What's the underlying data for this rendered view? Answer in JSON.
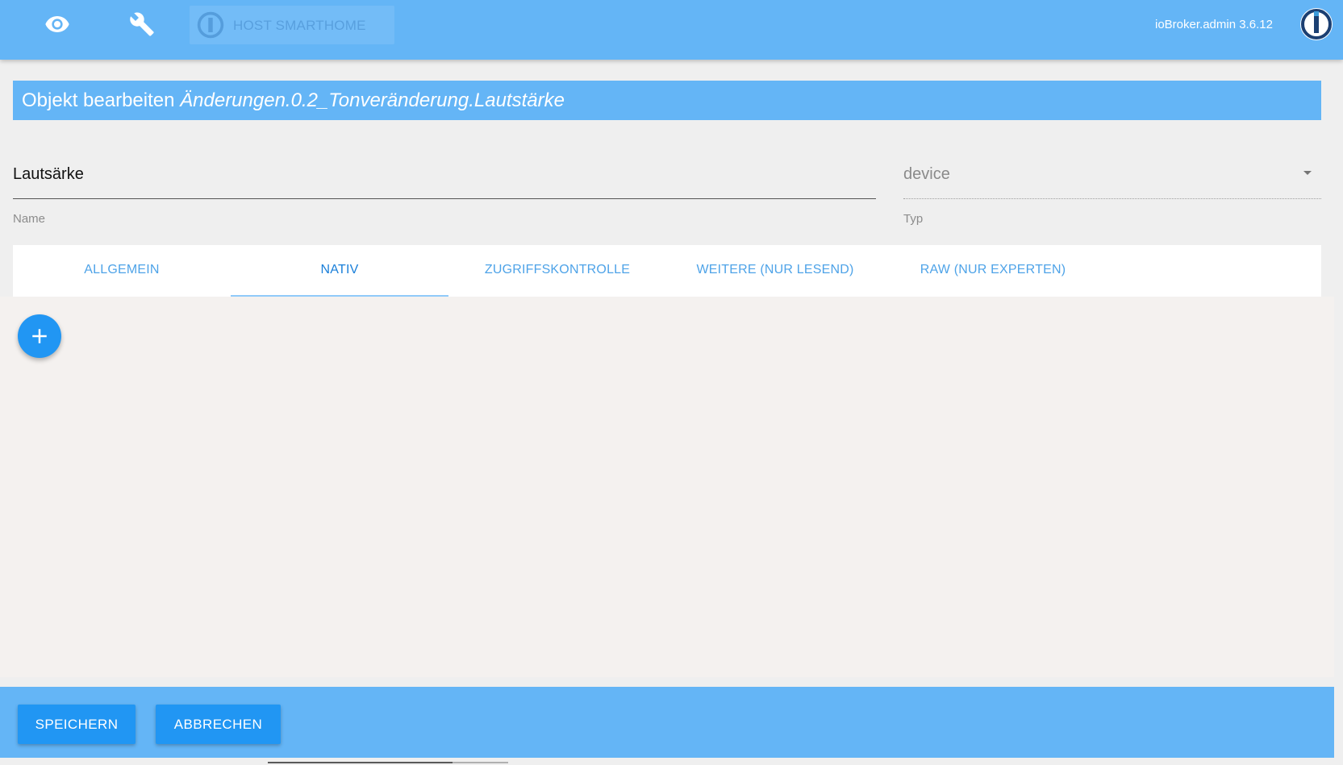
{
  "topbar": {
    "icons": {
      "view": "eye-icon",
      "settings": "wrench-icon",
      "host_logo": "iobroker-logo-icon",
      "app_logo": "iobroker-logo-icon"
    },
    "host_label": "HOST SMARTHOME",
    "version": "ioBroker.admin 3.6.12"
  },
  "dialog": {
    "title_prefix": "Objekt bearbeiten",
    "object_id": "Änderungen.0.2_Tonveränderung.Lautstärke"
  },
  "form": {
    "name": {
      "value": "Lautsärke",
      "label": "Name"
    },
    "type": {
      "value": "device",
      "label": "Typ",
      "icon": "dropdown-arrow-icon"
    }
  },
  "tabs": {
    "items": [
      {
        "label": "ALLGEMEIN"
      },
      {
        "label": "NATIV"
      },
      {
        "label": "ZUGRIFFSKONTROLLE"
      },
      {
        "label": "WEITERE (NUR LESEND)"
      },
      {
        "label": "RAW (NUR EXPERTEN)"
      }
    ],
    "active": "NATIV"
  },
  "native": {
    "add_button_icon": "plus-icon"
  },
  "actions": {
    "save_label": "SPEICHERN",
    "cancel_label": "ABBRECHEN"
  },
  "colors": {
    "primary": "#64b5f6",
    "accent": "#2196f3",
    "tab_text": "#4ea3e8",
    "tab_active_text": "#1a7fd9",
    "tab_indicator": "#90caf9",
    "page_background": "#efefef",
    "content_background": "#f4f1ef"
  }
}
